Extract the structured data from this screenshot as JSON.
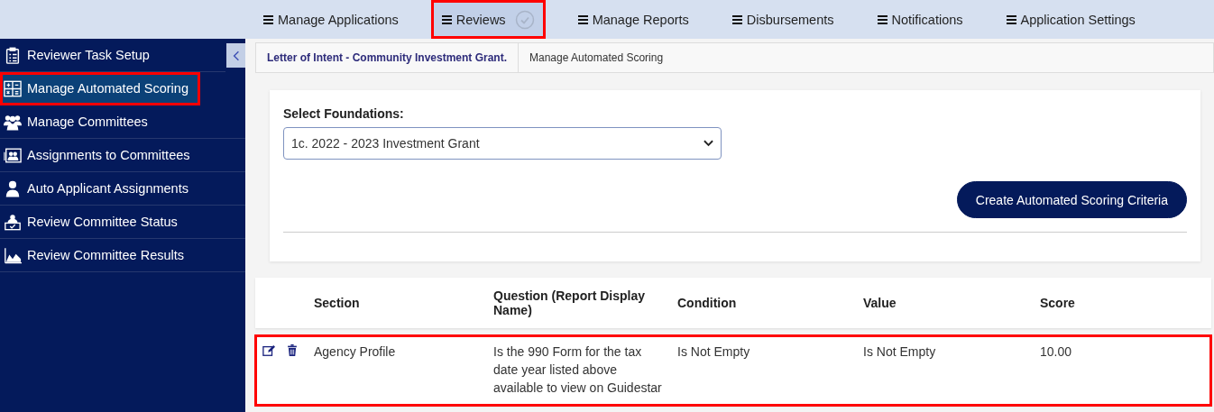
{
  "top_nav": [
    {
      "label": "Manage Applications",
      "selected": false,
      "highlighted": false,
      "check": false
    },
    {
      "label": "Reviews",
      "selected": true,
      "highlighted": true,
      "check": true
    },
    {
      "label": "Manage Reports",
      "selected": false,
      "highlighted": false,
      "check": false
    },
    {
      "label": "Disbursements",
      "selected": false,
      "highlighted": false,
      "check": false
    },
    {
      "label": "Notifications",
      "selected": false,
      "highlighted": false,
      "check": false
    },
    {
      "label": "Application Settings",
      "selected": false,
      "highlighted": false,
      "check": false
    }
  ],
  "sidebar": {
    "items": [
      {
        "label": "Reviewer Task Setup",
        "selected": false,
        "highlighted": false
      },
      {
        "label": "Manage Automated Scoring",
        "selected": true,
        "highlighted": true
      },
      {
        "label": "Manage Committees",
        "selected": false,
        "highlighted": false
      },
      {
        "label": "Assignments to Committees",
        "selected": false,
        "highlighted": false
      },
      {
        "label": "Auto Applicant Assignments",
        "selected": false,
        "highlighted": false
      },
      {
        "label": "Review Committee Status",
        "selected": false,
        "highlighted": false
      },
      {
        "label": "Review Committee Results",
        "selected": false,
        "highlighted": false
      }
    ]
  },
  "breadcrumb": [
    "Letter of Intent - Community Investment Grant.",
    "Manage Automated Scoring"
  ],
  "foundation": {
    "label": "Select Foundations:",
    "value": "1c. 2022 - 2023 Investment Grant"
  },
  "create_button": "Create Automated Scoring Criteria",
  "table": {
    "columns": [
      "Section",
      "Question (Report Display Name)",
      "Condition",
      "Value",
      "Score"
    ],
    "rows": [
      {
        "highlighted": true,
        "cells": [
          "Agency Profile",
          "Is the 990 Form for the tax date year listed above available to view on Guidestar",
          "Is Not Empty",
          "Is Not Empty",
          "10.00"
        ]
      }
    ]
  }
}
